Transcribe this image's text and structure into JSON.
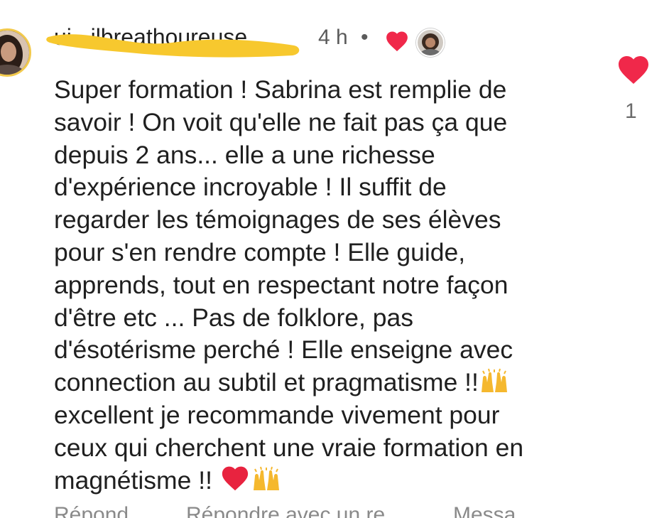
{
  "comment": {
    "author": "ui...ilbreathoureuse",
    "time": "4 h",
    "separator": "•",
    "body_lines": [
      "Super formation ! Sabrina est remplie de",
      "savoir ! On voit qu'elle ne fait pas ça que",
      "depuis 2 ans... elle a une richesse",
      "d'expérience incroyable ! Il suffit de",
      "regarder les témoignages de ses élèves",
      "pour s'en rendre compte ! Elle guide,",
      "apprends, tout en respectant notre façon",
      "d'être etc ... Pas de folklore, pas",
      "d'ésotérisme perché ! Elle enseigne avec",
      "connection au subtil et pragmatisme !!",
      "excellent je recommande vivement pour",
      "ceux qui cherchent une vraie formation en",
      "magnétisme !! "
    ],
    "like_count": "1"
  },
  "actions": {
    "reply": "Répond...",
    "reply_with": "Répondre avec un re...",
    "message": "Messa..."
  },
  "icons": {
    "avatar": "profile-photo",
    "reaction_heart": "heart-icon",
    "reactor_avatar": "reactor-avatar",
    "like": "heart-icon",
    "emoji_hands": "raising-hands-emoji",
    "emoji_heart": "red-heart-emoji"
  },
  "colors": {
    "heart_red": "#f0284a",
    "redaction_yellow": "#f7c82e",
    "avatar_ring": "#f2c94c"
  }
}
